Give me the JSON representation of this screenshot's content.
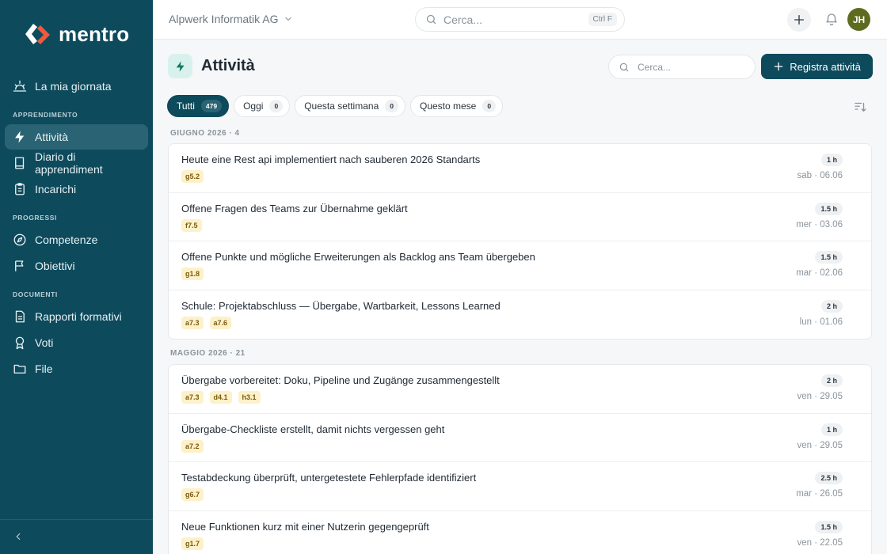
{
  "brand": {
    "name": "mentro"
  },
  "sidebar": {
    "top_item": {
      "label": "La mia giornata",
      "icon": "sunrise-icon"
    },
    "sections": [
      {
        "label": "APPRENDIMENTO",
        "items": [
          {
            "label": "Attività",
            "icon": "bolt-icon",
            "active": true
          },
          {
            "label": "Diario di apprendiment",
            "icon": "book-icon"
          },
          {
            "label": "Incarichi",
            "icon": "clipboard-icon"
          }
        ]
      },
      {
        "label": "PROGRESSI",
        "items": [
          {
            "label": "Competenze",
            "icon": "compass-icon"
          },
          {
            "label": "Obiettivi",
            "icon": "flag-icon"
          }
        ]
      },
      {
        "label": "DOCUMENTI",
        "items": [
          {
            "label": "Rapporti formativi",
            "icon": "document-icon"
          },
          {
            "label": "Voti",
            "icon": "award-icon"
          },
          {
            "label": "File",
            "icon": "folder-icon"
          }
        ]
      }
    ]
  },
  "topbar": {
    "org": "Alpwerk Informatik AG",
    "search_placeholder": "Cerca...",
    "search_shortcut": "Ctrl F",
    "avatar_initials": "JH"
  },
  "page": {
    "title": "Attività",
    "search_placeholder": "Cerca...",
    "primary_action": "Registra attività"
  },
  "tabs": [
    {
      "label": "Tutti",
      "count": "479",
      "active": true
    },
    {
      "label": "Oggi",
      "count": "0"
    },
    {
      "label": "Questa settimana",
      "count": "0"
    },
    {
      "label": "Questo mese",
      "count": "0"
    }
  ],
  "groups": [
    {
      "label": "GIUGNO 2026 · 4",
      "items": [
        {
          "title": "Heute eine Rest api implementiert nach sauberen 2026 Standarts",
          "tags": [
            "g5.2"
          ],
          "hours": "1 h",
          "date": "sab · 06.06"
        },
        {
          "title": "Offene Fragen des Teams zur Übernahme geklärt",
          "tags": [
            "f7.5"
          ],
          "hours": "1.5 h",
          "date": "mer · 03.06"
        },
        {
          "title": "Offene Punkte und mögliche Erweiterungen als Backlog ans Team übergeben",
          "tags": [
            "g1.8"
          ],
          "hours": "1.5 h",
          "date": "mar · 02.06"
        },
        {
          "title": "Schule: Projektabschluss — Übergabe, Wartbarkeit, Lessons Learned",
          "tags": [
            "a7.3",
            "a7.6"
          ],
          "hours": "2 h",
          "date": "lun · 01.06"
        }
      ]
    },
    {
      "label": "MAGGIO 2026 · 21",
      "items": [
        {
          "title": "Übergabe vorbereitet: Doku, Pipeline und Zugänge zusammengestellt",
          "tags": [
            "a7.3",
            "d4.1",
            "h3.1"
          ],
          "hours": "2 h",
          "date": "ven · 29.05"
        },
        {
          "title": "Übergabe-Checkliste erstellt, damit nichts vergessen geht",
          "tags": [
            "a7.2"
          ],
          "hours": "1 h",
          "date": "ven · 29.05"
        },
        {
          "title": "Testabdeckung überprüft, untergetestete Fehlerpfade identifiziert",
          "tags": [
            "g6.7"
          ],
          "hours": "2.5 h",
          "date": "mar · 26.05"
        },
        {
          "title": "Neue Funktionen kurz mit einer Nutzerin gegengeprüft",
          "tags": [
            "g1.7"
          ],
          "hours": "1.5 h",
          "date": "ven · 22.05"
        }
      ]
    }
  ]
}
